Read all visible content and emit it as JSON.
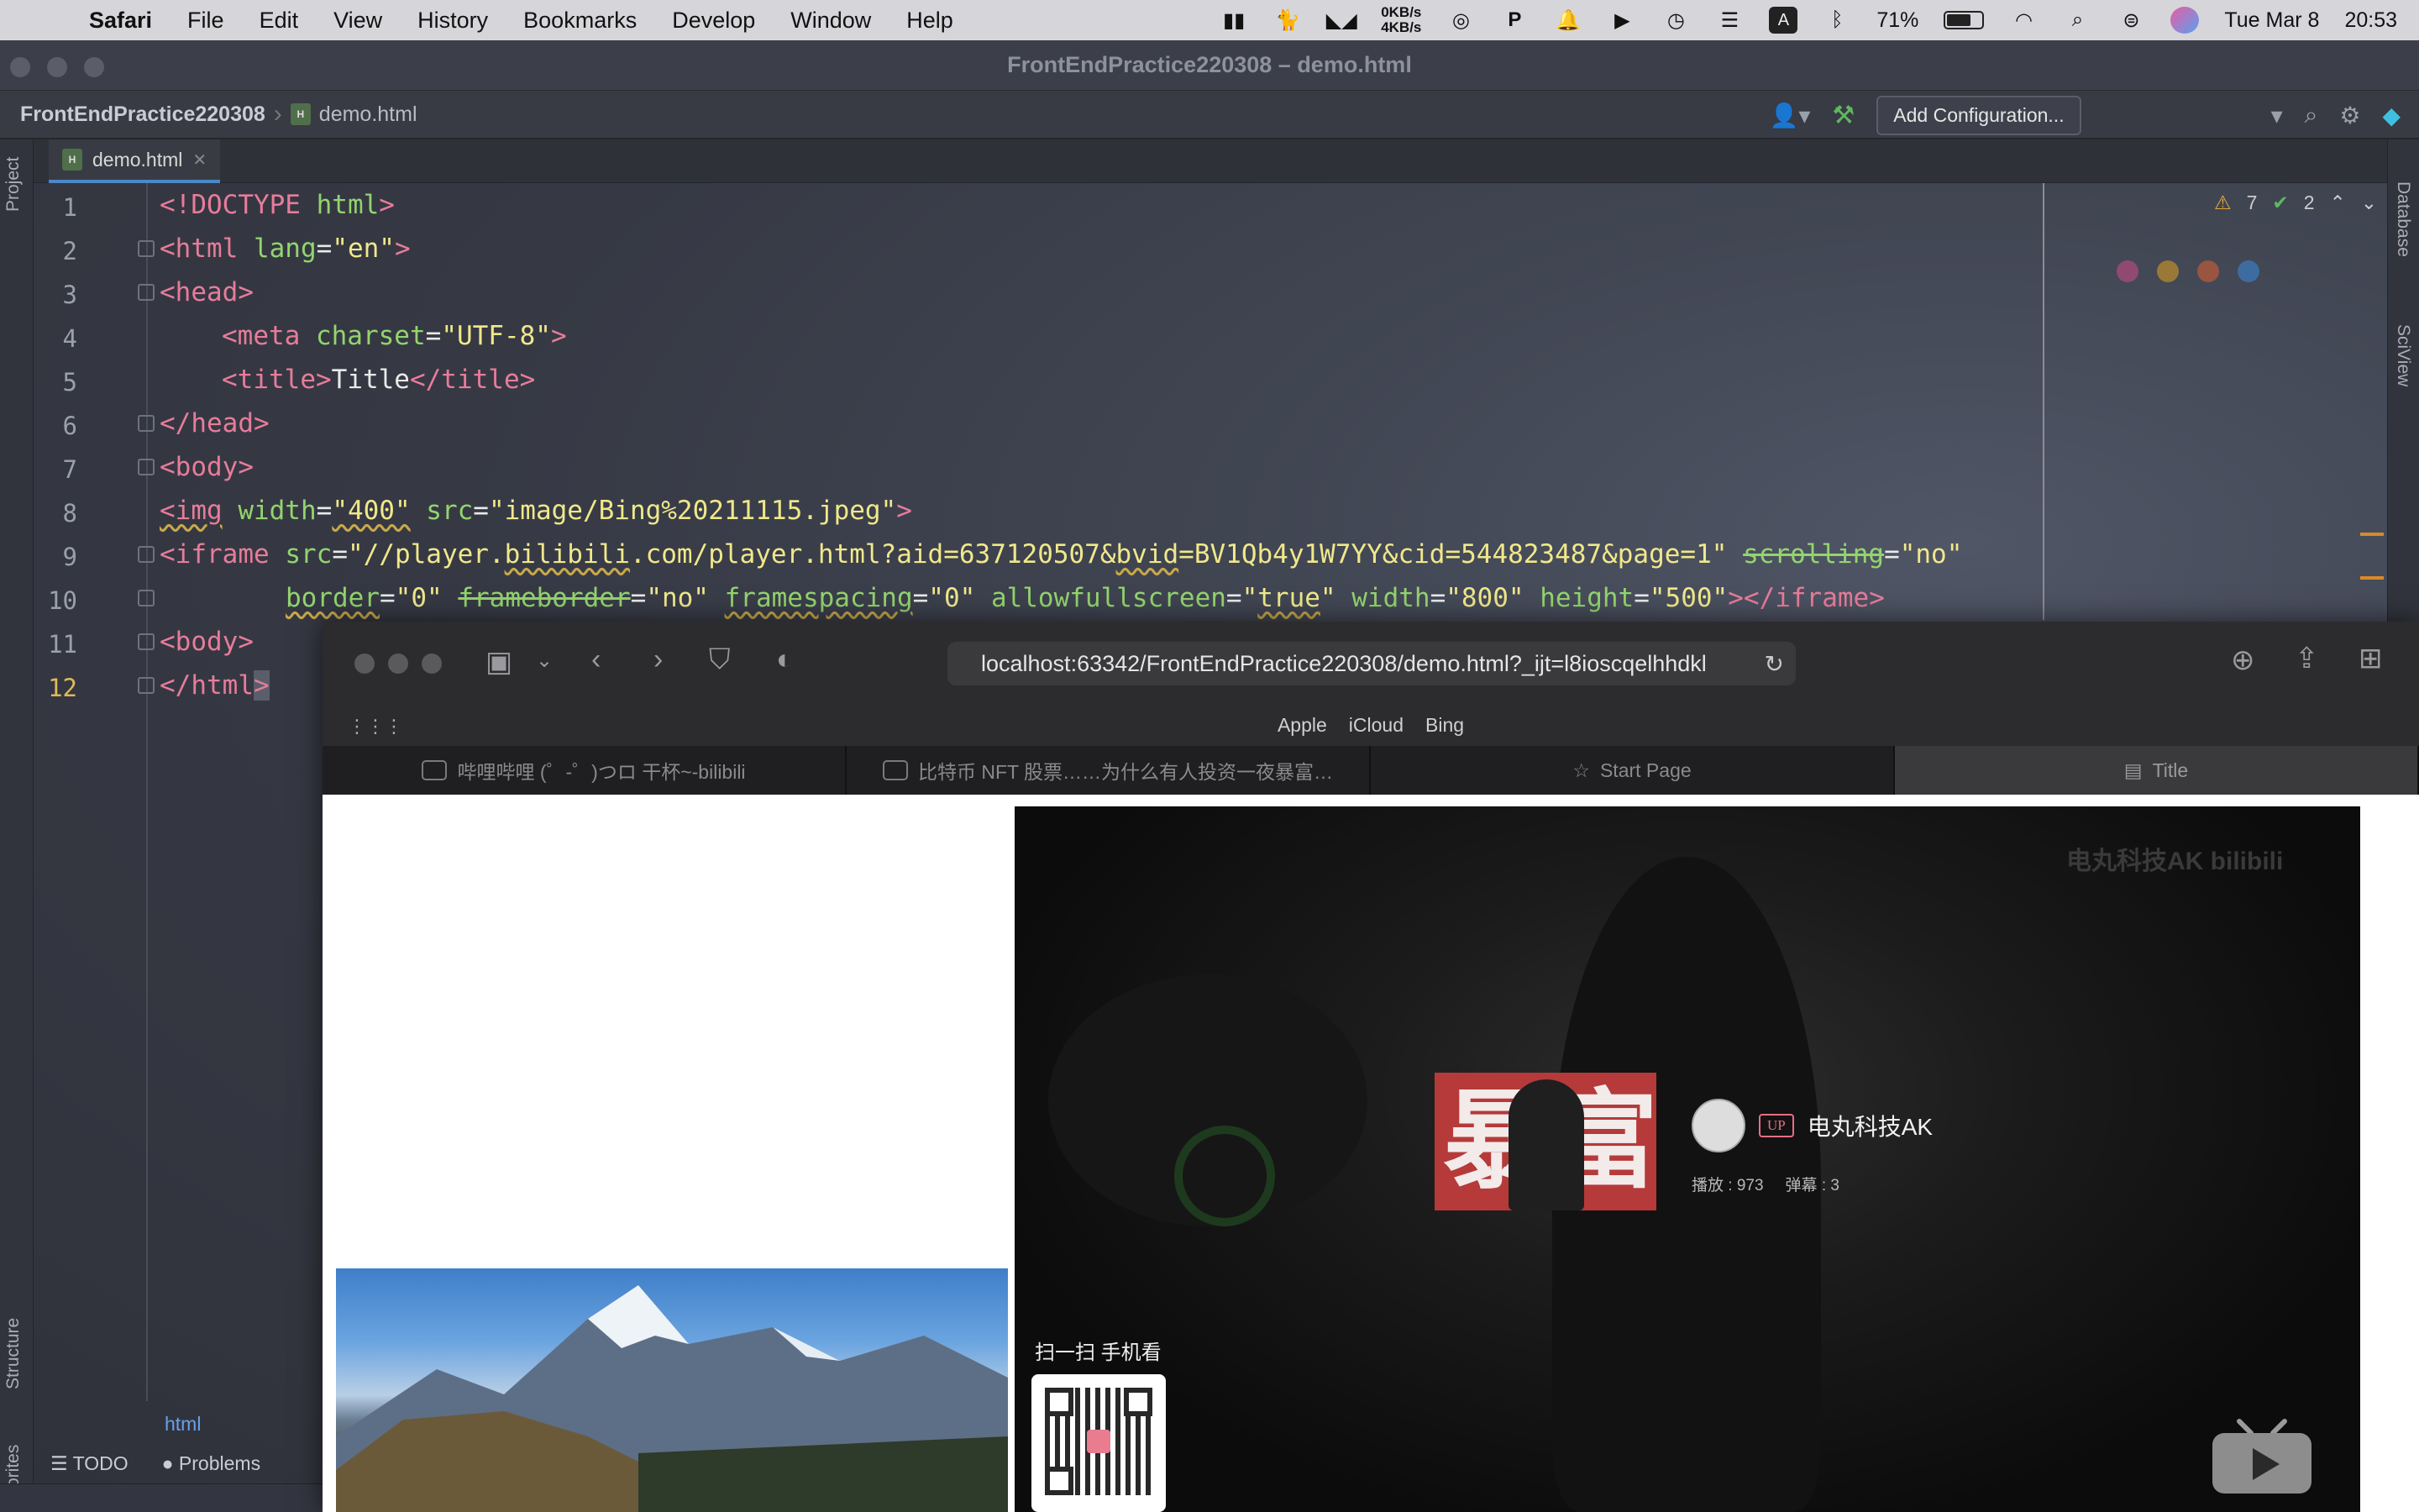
{
  "menubar": {
    "app_name": "Safari",
    "items": [
      "File",
      "Edit",
      "View",
      "History",
      "Bookmarks",
      "Develop",
      "Window",
      "Help"
    ],
    "net_up": "0KB/s",
    "net_down": "4KB/s",
    "battery_level": 0.71,
    "battery": "71%",
    "date": "Tue Mar 8",
    "time": "20:53"
  },
  "ide": {
    "window_title": "FrontEndPractice220308 – demo.html",
    "project_name": "FrontEndPractice220308",
    "file_name": "demo.html",
    "run_config_label": "Add Configuration...",
    "tab_label": "demo.html",
    "left_strip": [
      "Project",
      "Structure",
      "Favorites"
    ],
    "right_strip": [
      "Database",
      "SciView"
    ],
    "warnings_count": "7",
    "checks_count": "2",
    "breadcrumb": "html",
    "bottom_tabs": [
      "TODO",
      "Problems"
    ],
    "line_numbers": [
      "1",
      "2",
      "3",
      "4",
      "5",
      "6",
      "7",
      "8",
      "9",
      "10",
      "11",
      "12"
    ],
    "code": {
      "l1": [
        "<!DOCTYPE ",
        "html",
        ">"
      ],
      "l2": [
        "<html ",
        "lang",
        "=",
        "\"en\"",
        ">"
      ],
      "l3": [
        "<head>"
      ],
      "l4": [
        "<meta ",
        "charset",
        "=",
        "\"UTF-8\"",
        ">"
      ],
      "l5": [
        "<title>",
        "Title",
        "</title>"
      ],
      "l6": [
        "</head>"
      ],
      "l7": [
        "<body>"
      ],
      "l8": [
        "<img",
        " width",
        "=",
        "\"400\"",
        " src",
        "=",
        "\"image/Bing%20211115.jpeg\"",
        ">"
      ],
      "l9": [
        "<iframe ",
        "src",
        "=",
        "\"//player.",
        "bilibili",
        ".com/player.html?aid=637120507&",
        "bvid",
        "=BV1Qb4y1W7YY&cid=544823487&page=1\"",
        " ",
        "scrolling",
        "=",
        "\"no\""
      ],
      "l10": [
        "border",
        "=",
        "\"0\"",
        " ",
        "frameborder",
        "=",
        "\"no\"",
        " ",
        "framespacing",
        "=",
        "\"0\"",
        " allowfullscreen",
        "=",
        "\"",
        "true",
        "\"",
        " width",
        "=",
        "\"800\"",
        " height",
        "=",
        "\"500\"",
        "></iframe>"
      ],
      "l11": [
        "<",
        "body",
        ">"
      ],
      "l12": [
        "</html",
        ">"
      ]
    }
  },
  "safari": {
    "url": "localhost:63342/FrontEndPractice220308/demo.html?_ijt=l8ioscqelhhdkl",
    "favorites": [
      "Apple",
      "iCloud",
      "Bing"
    ],
    "tabs": [
      "哔哩哔哩 (゜-゜)つロ 干杯~-bilibili",
      "比特币 NFT 股票……为什么有人投资一夜暴富…",
      "Start Page",
      "Title"
    ],
    "player": {
      "watermark": "电丸科技AK  bilibili",
      "cover_chars": [
        "暴",
        "富"
      ],
      "up_badge": "UP",
      "uploader_name": "电丸科技AK",
      "plays": "播放 : 973",
      "danmaku": "弹幕 : 3",
      "scan_text": "扫一扫 手机看"
    }
  }
}
